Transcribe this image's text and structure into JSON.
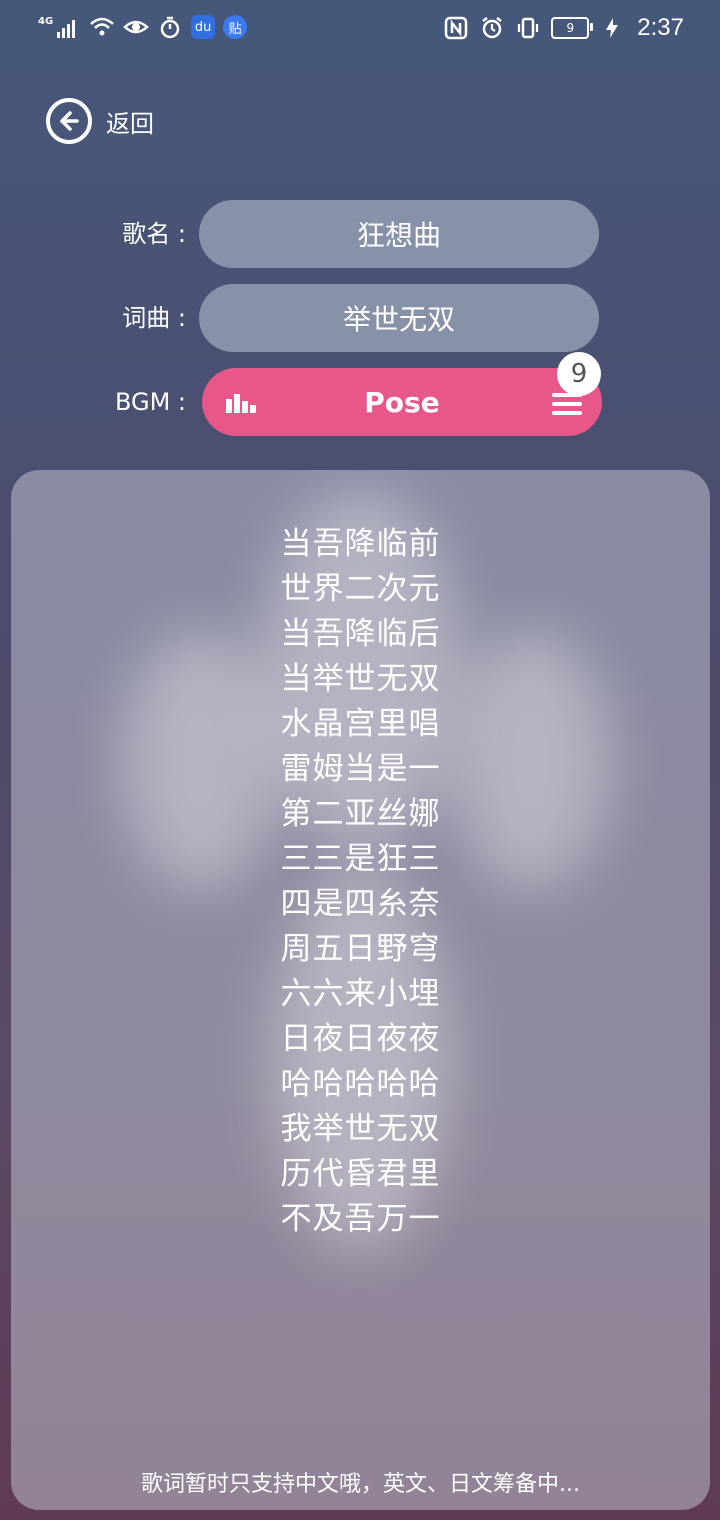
{
  "status_bar": {
    "network": "4G",
    "tile_baidu": "du",
    "tile_tieba": "贴",
    "battery_level": "9",
    "time": "2:37"
  },
  "back": {
    "label": "返回"
  },
  "form": {
    "song_name_label": "歌名 :",
    "song_name_value": "狂想曲",
    "lyricist_label": "词曲 :",
    "lyricist_value": "举世无双",
    "bgm_label": "BGM :",
    "bgm_value": "Pose",
    "bgm_badge": "9"
  },
  "lyrics": [
    "当吾降临前",
    "世界二次元",
    "当吾降临后",
    "当举世无双",
    "水晶宫里唱",
    "雷姆当是一",
    "第二亚丝娜",
    "三三是狂三",
    "四是四糸奈",
    "周五日野穹",
    "六六来小埋",
    "日夜日夜夜",
    "哈哈哈哈哈",
    "我举世无双",
    "历代昏君里",
    "不及吾万一"
  ],
  "footer_note": "歌词暂时只支持中文哦，英文、日文筹备中...",
  "colors": {
    "accent": "#e8578a",
    "pill": "#a0aabe"
  }
}
